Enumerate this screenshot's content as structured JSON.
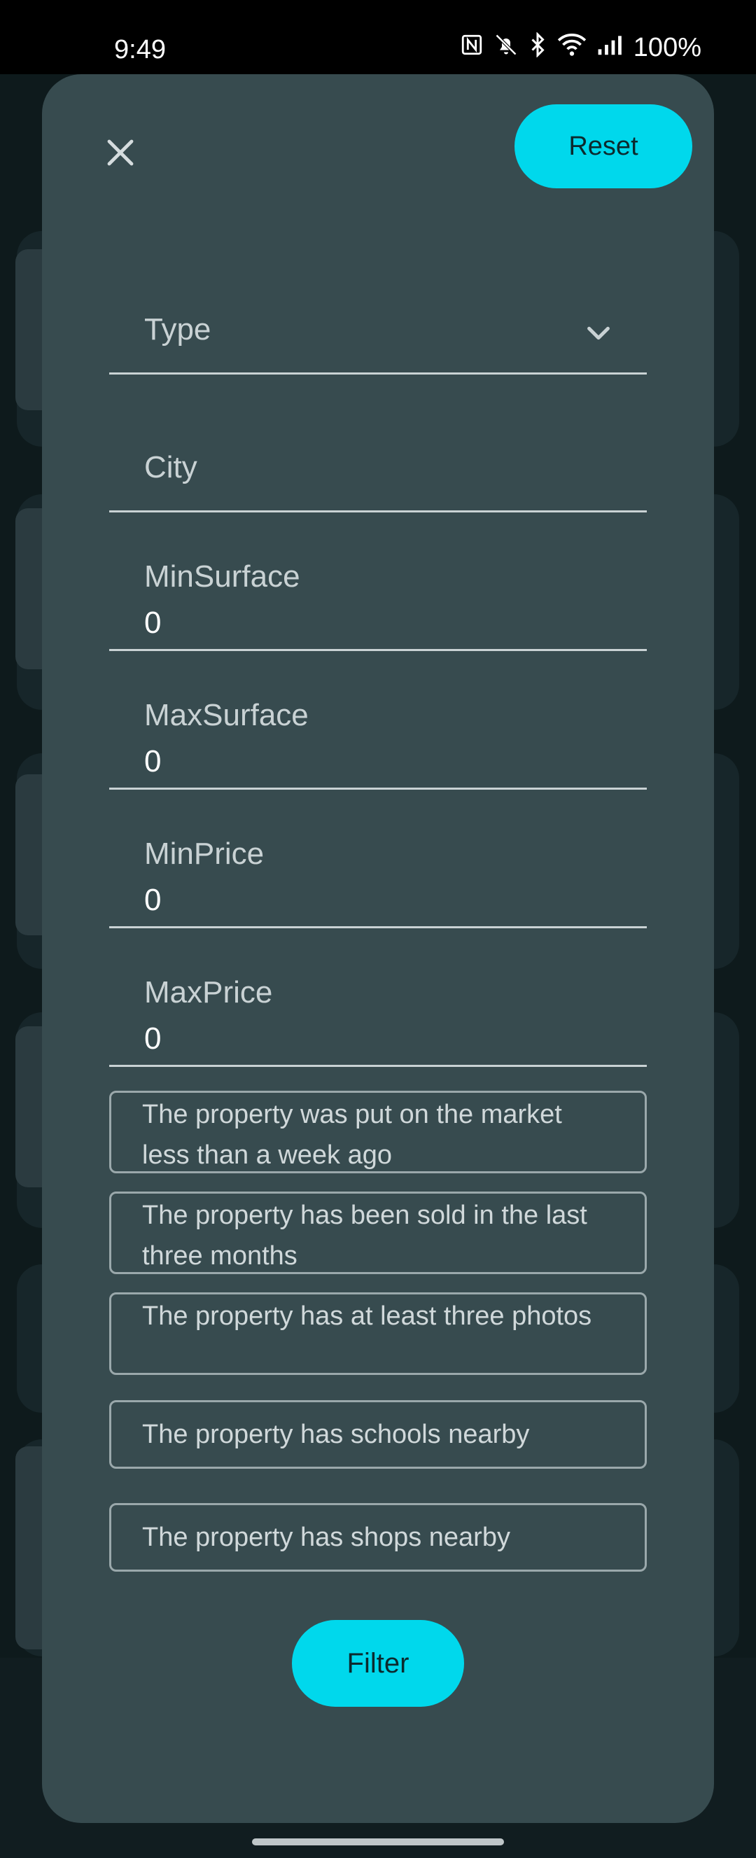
{
  "status_bar": {
    "time": "9:49",
    "battery": "100%",
    "icons": [
      "nfc-icon",
      "bell-off-icon",
      "bluetooth-icon",
      "wifi-icon",
      "signal-icon"
    ]
  },
  "dialog": {
    "close_icon": "close-icon",
    "reset_label": "Reset",
    "fields": {
      "type": {
        "label": "Type"
      },
      "city": {
        "label": "City"
      },
      "min_surface": {
        "label": "MinSurface",
        "value": "0"
      },
      "max_surface": {
        "label": "MaxSurface",
        "value": "0"
      },
      "min_price": {
        "label": "MinPrice",
        "value": "0"
      },
      "max_price": {
        "label": "MaxPrice",
        "value": "0"
      }
    },
    "chips": {
      "week": "The property was put on the market less than a week ago",
      "sold": "The property has been sold in the last three months",
      "photos": "The property has at least three photos",
      "schools": "The property has schools nearby",
      "shops": "The property has shops nearby"
    },
    "filter_label": "Filter"
  },
  "colors": {
    "dialog_bg": "#374b4f",
    "accent": "#00d8ec",
    "text_muted": "#c9d2d4"
  }
}
